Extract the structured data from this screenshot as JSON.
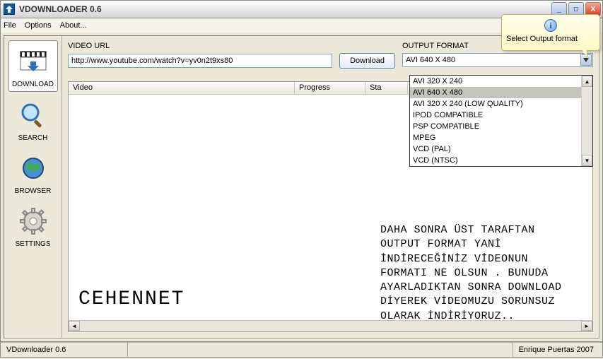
{
  "window": {
    "title": "VDOWNLOADER 0.6",
    "menu": {
      "file": "File",
      "options": "Options",
      "about": "About..."
    },
    "btn_min": "_",
    "btn_max": "□",
    "btn_close": "X"
  },
  "sidebar": {
    "items": [
      {
        "label": "DOWNLOAD"
      },
      {
        "label": "SEARCH"
      },
      {
        "label": "BROWSER"
      },
      {
        "label": "SETTINGS"
      }
    ]
  },
  "header": {
    "url_label": "VIDEO URL",
    "url_value": "http://www.youtube.com/watch?v=yv0n2t9xs80",
    "download_btn": "Download",
    "format_label": "OUTPUT FORMAT",
    "format_selected": "AVI 640 X 480"
  },
  "dropdown": {
    "items": [
      "AVI 320 X 240",
      "AVI 640 X 480",
      "AVI 320 X 240 (LOW QUALITY)",
      "IPOD COMPATIBLE",
      "PSP COMPATIBLE",
      "MPEG",
      "VCD (PAL)",
      "VCD (NTSC)"
    ],
    "selected_index": 1
  },
  "list": {
    "cols": {
      "video": "Video",
      "progress": "Progress",
      "status": "Sta"
    }
  },
  "tooltip": {
    "text": "Select Output format"
  },
  "overlay_note": "DAHA SONRA ÜST TARAFTAN OUTPUT FORMAT YANİ İNDİRECEĞİNİZ VİDEONUN FORMATI NE OLSUN . BUNUDA AYARLADIKTAN SONRA DOWNLOAD DİYEREK VİDEOMUZU SORUNSUZ OLARAK İNDİRİYORUZ..",
  "watermark": "CEHENNET",
  "statusbar": {
    "left": "VDownloader 0.6",
    "right": "Enrique Puertas 2007"
  }
}
